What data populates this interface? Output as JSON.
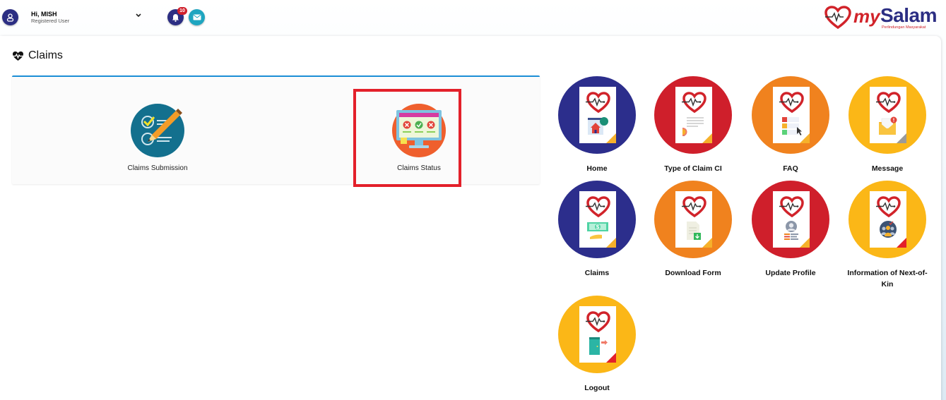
{
  "header": {
    "greeting": "Hi, MISH",
    "role": "Registered User",
    "notification_count": "10",
    "logo": {
      "brand_my": "my",
      "brand_salam": "Salam",
      "tagline": "Perlindungan Masyarakat"
    }
  },
  "page": {
    "title": "Claims",
    "title_icon": "heartbeat-icon"
  },
  "claims_options": [
    {
      "label": "Claims Submission",
      "icon": "checklist-pen-icon"
    },
    {
      "label": "Claims Status",
      "icon": "monitor-status-icon",
      "highlighted": true
    }
  ],
  "tiles": [
    {
      "label": "Home",
      "color": "#2c2e8c",
      "icon": "home-icon",
      "fold": "#f6b12b"
    },
    {
      "label": "Type of Claim CI",
      "color": "#cf1f2b",
      "icon": "certificate-icon",
      "fold": "#f6b12b"
    },
    {
      "label": "FAQ",
      "color": "#f0821e",
      "icon": "faq-icon",
      "fold": "#f6b12b"
    },
    {
      "label": "Message",
      "color": "#fbb717",
      "icon": "envelope-icon",
      "fold": "#9a9a9a"
    },
    {
      "label": "Claims",
      "color": "#2c2e8c",
      "icon": "money-icon",
      "fold": "#f6b12b"
    },
    {
      "label": "Download Form",
      "color": "#f0821e",
      "icon": "download-icon",
      "fold": "#f6b12b"
    },
    {
      "label": "Update Profile",
      "color": "#cf1f2b",
      "icon": "profile-icon",
      "fold": "#f6b12b"
    },
    {
      "label": "Information of Next-of-Kin",
      "color": "#fbb717",
      "icon": "family-icon",
      "fold": "#e3202a"
    },
    {
      "label": "Logout",
      "color": "#fbb717",
      "icon": "logout-icon",
      "fold": "#e3202a"
    }
  ],
  "colors": {
    "primary": "#2c2e83",
    "accent_red": "#e3202a",
    "card_border": "#1b8ed6"
  }
}
